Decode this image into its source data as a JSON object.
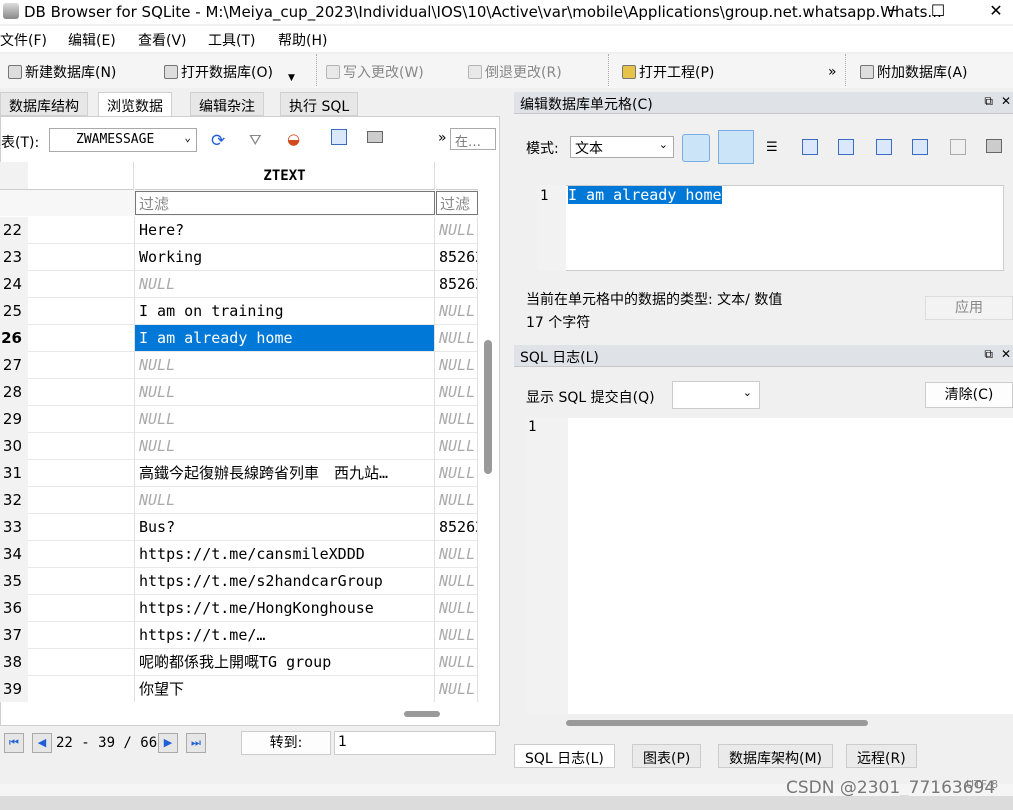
{
  "window": {
    "title": "DB Browser for SQLite - M:\\Meiya_cup_2023\\Individual\\IOS\\10\\Active\\var\\mobile\\Applications\\group.net.whatsapp.Whats...",
    "minimize": "─",
    "maximize": "☐",
    "close": "✕"
  },
  "menu": [
    "文件(F)",
    "编辑(E)",
    "查看(V)",
    "工具(T)",
    "帮助(H)"
  ],
  "toolbar": {
    "new_db": "新建数据库(N)",
    "open_db": "打开数据库(O)",
    "write_changes": "写入更改(W)",
    "revert_changes": "倒退更改(R)",
    "open_project": "打开工程(P)",
    "more": "»",
    "attach_db": "附加数据库(A)"
  },
  "tabs": [
    "数据库结构",
    "浏览数据",
    "编辑杂注",
    "执行 SQL"
  ],
  "browse": {
    "table_label": "表(T):",
    "table_selected": "ZWAMESSAGE",
    "more": "»",
    "filter_right": "在…",
    "column_header": "ZTEXT",
    "filter_placeholder": "过滤",
    "rows": [
      {
        "num": "22",
        "text": "Here?",
        "next": "NULL"
      },
      {
        "num": "23",
        "text": "Working",
        "next": "85262"
      },
      {
        "num": "24",
        "text": "NULL",
        "next": "85262"
      },
      {
        "num": "25",
        "text": "I am on training",
        "next": "NULL"
      },
      {
        "num": "26",
        "text": "I am already home",
        "next": "NULL"
      },
      {
        "num": "27",
        "text": "NULL",
        "next": "NULL"
      },
      {
        "num": "28",
        "text": "NULL",
        "next": "NULL"
      },
      {
        "num": "29",
        "text": "NULL",
        "next": "NULL"
      },
      {
        "num": "30",
        "text": "NULL",
        "next": "NULL"
      },
      {
        "num": "31",
        "text": "高鐵今起復辦長線跨省列車　西九站…",
        "next": "NULL"
      },
      {
        "num": "32",
        "text": "NULL",
        "next": "NULL"
      },
      {
        "num": "33",
        "text": "Bus?",
        "next": "85262"
      },
      {
        "num": "34",
        "text": "https://t.me/cansmileXDDD",
        "next": "NULL"
      },
      {
        "num": "35",
        "text": "https://t.me/s2handcarGroup",
        "next": "NULL"
      },
      {
        "num": "36",
        "text": "https://t.me/HongKonghouse",
        "next": "NULL"
      },
      {
        "num": "37",
        "text": "https://t.me/…",
        "next": "NULL"
      },
      {
        "num": "38",
        "text": "呢啲都係我上開嘅TG group",
        "next": "NULL"
      },
      {
        "num": "39",
        "text": "你望下",
        "next": "NULL"
      }
    ],
    "selected_row": "26"
  },
  "pager": {
    "range": "22 - 39 / 66",
    "goto_label": "转到:",
    "goto_value": "1"
  },
  "edit_cell": {
    "title": "编辑数据库单元格(C)",
    "mode_label": "模式:",
    "mode_value": "文本",
    "line_number": "1",
    "content": "I am already home",
    "type_info": "当前在单元格中的数据的类型: 文本/ 数值",
    "char_count": "17 个字符",
    "apply": "应用"
  },
  "sql_log": {
    "title": "SQL 日志(L)",
    "submit_label": "显示 SQL 提交自(Q)",
    "clear": "清除(C)",
    "line_number": "1"
  },
  "bottom_tabs": [
    "SQL 日志(L)",
    "图表(P)",
    "数据库架构(M)",
    "远程(R)"
  ],
  "status": {
    "encoding": "UTF-8",
    "watermark": "CSDN @2301_77163694"
  },
  "colors": {
    "selection": "#0078d7",
    "accent_blue": "#1f5fd6"
  }
}
